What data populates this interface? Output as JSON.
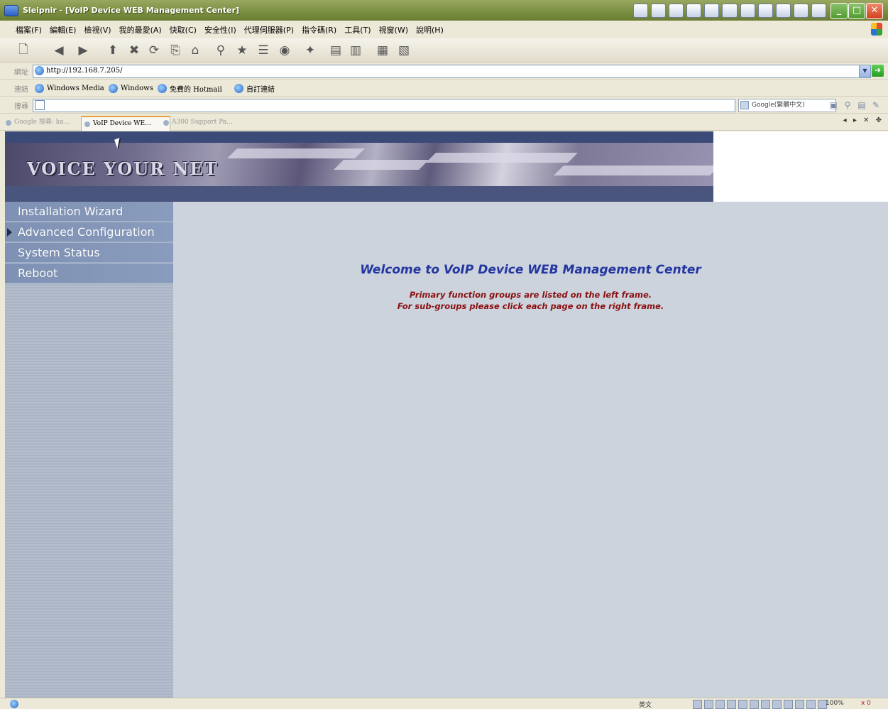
{
  "window": {
    "title": "Sleipnir - [VoIP Device WEB Management Center]"
  },
  "menu": {
    "items": [
      "檔案(F)",
      "編輯(E)",
      "檢視(V)",
      "我的最愛(A)",
      "快取(C)",
      "安全性(I)",
      "代理伺服器(P)",
      "指令碼(R)",
      "工具(T)",
      "視窗(W)",
      "說明(H)"
    ]
  },
  "address": {
    "label": "網址",
    "url": "http://192.168.7.205/"
  },
  "links": {
    "label": "連結",
    "items": [
      "Windows Media",
      "Windows",
      "免費的 Hotmail",
      "自訂連結"
    ]
  },
  "search": {
    "label": "搜尋",
    "engine": "Google(繁體中文)"
  },
  "tabs": [
    {
      "label": "Google 搜尋: ka..."
    },
    {
      "label": "VoIP Device WE..."
    },
    {
      "label": "A300 Support Pa..."
    }
  ],
  "tab_nav": "◂ ▸ ✕ ✥",
  "page": {
    "banner_text": "VOICE YOUR NET",
    "nav": [
      {
        "label": "Installation Wizard"
      },
      {
        "label": "Advanced Configuration"
      },
      {
        "label": "System Status"
      },
      {
        "label": "Reboot"
      }
    ],
    "welcome_title": "Welcome to VoIP Device WEB Management Center",
    "welcome_line1": "Primary function groups are listed on the left frame.",
    "welcome_line2": "For sub-groups please click each page on the right frame."
  },
  "status": {
    "language": "英文",
    "zoom": "100%",
    "errors": "x 0"
  },
  "colors": {
    "title_accent": "#2436a0",
    "body_text": "#8a1010",
    "sidebar": "#8a9cbd",
    "frame_bg": "#ccd3dd"
  }
}
